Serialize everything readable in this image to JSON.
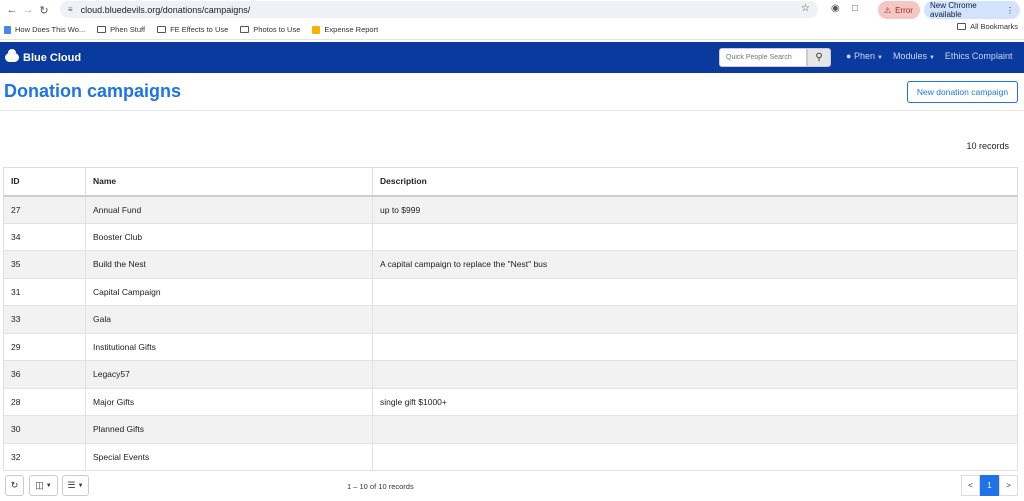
{
  "browser": {
    "url": "cloud.bluedevils.org/donations/campaigns/",
    "error_label": "Error",
    "update_label": "New Chrome available",
    "bookmarks": [
      "How Does This Wo...",
      "Phen Stuff",
      "FE Effects to Use",
      "Photos to Use",
      "Expense Report"
    ],
    "all_bookmarks": "All Bookmarks"
  },
  "navbar": {
    "brand": "Blue Cloud",
    "search_placeholder": "Quick People Search",
    "links": [
      "Phen",
      "Modules",
      "Ethics Complaint"
    ]
  },
  "page": {
    "title": "Donation campaigns",
    "new_button": "New donation campaign",
    "records_count": "10 records"
  },
  "table": {
    "headers": [
      "ID",
      "Name",
      "Description"
    ],
    "rows": [
      [
        "27",
        "Annual Fund",
        "up to $999"
      ],
      [
        "34",
        "Booster Club",
        ""
      ],
      [
        "35",
        "Build the Nest",
        "A capital campaign to replace the \"Nest\" bus"
      ],
      [
        "31",
        "Capital Campaign",
        ""
      ],
      [
        "33",
        "Gala",
        ""
      ],
      [
        "29",
        "Institutional Gifts",
        ""
      ],
      [
        "36",
        "Legacy57",
        ""
      ],
      [
        "28",
        "Major Gifts",
        "single gift $1000+"
      ],
      [
        "30",
        "Planned Gifts",
        ""
      ],
      [
        "32",
        "Special Events",
        ""
      ]
    ]
  },
  "footer": {
    "page_info": "1 – 10 of 10 records",
    "prev": "<",
    "current_page": "1",
    "next": ">"
  },
  "colors": {
    "navbar": "#0a3a9e",
    "accent": "#1e73e8"
  }
}
